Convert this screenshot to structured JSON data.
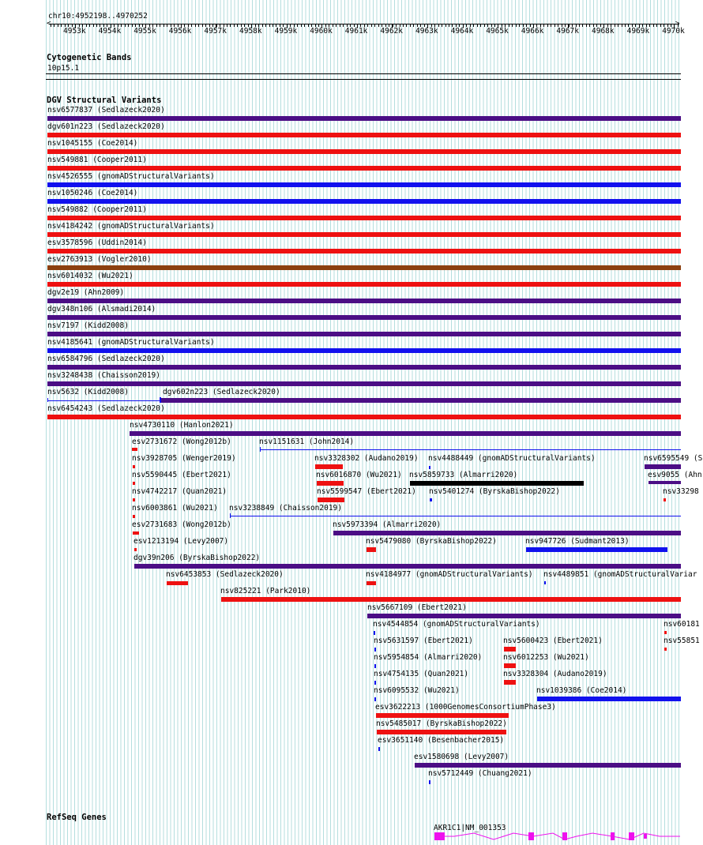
{
  "colors": {
    "red": "#ee1111",
    "blue": "#1111ee",
    "purple": "#4b0e85",
    "brown": "#8c4010",
    "black": "#000000",
    "magenta": "#ee11ee",
    "grid": "#b4dede"
  },
  "ruler": {
    "position_label": "chr10:4952198..4970252",
    "ticks": [
      "4953k",
      "4954k",
      "4955k",
      "4956k",
      "4957k",
      "4958k",
      "4959k",
      "4960k",
      "4961k",
      "4962k",
      "4963k",
      "4964k",
      "4965k",
      "4966k",
      "4967k",
      "4968k",
      "4969k",
      "4970k"
    ]
  },
  "cytoband": {
    "title": "Cytogenetic Bands",
    "band_label": "10p15.1"
  },
  "dgv": {
    "title": "DGV Structural Variants",
    "features": [
      {
        "label": "nsv6577837 (Sedlazeck2020)",
        "color": "purple"
      },
      {
        "label": "dgv601n223 (Sedlazeck2020)",
        "color": "red"
      },
      {
        "label": "nsv1045155 (Coe2014)",
        "color": "red"
      },
      {
        "label": "nsv549881 (Cooper2011)",
        "color": "red"
      },
      {
        "label": "nsv4526555 (gnomADStructuralVariants)",
        "color": "blue"
      },
      {
        "label": "nsv1050246 (Coe2014)",
        "color": "blue"
      },
      {
        "label": "nsv549882 (Cooper2011)",
        "color": "red"
      },
      {
        "label": "nsv4184242 (gnomADStructuralVariants)",
        "color": "red"
      },
      {
        "label": "esv3578596 (Uddin2014)",
        "color": "red"
      },
      {
        "label": "esv2763913 (Vogler2010)",
        "color": "brown"
      },
      {
        "label": "nsv6014032 (Wu2021)",
        "color": "red"
      },
      {
        "label": "dgv2e19 (Ahn2009)",
        "color": "purple"
      },
      {
        "label": "dgv348n106 (Alsmadi2014)",
        "color": "purple"
      },
      {
        "label": "nsv7197 (Kidd2008)",
        "color": "purple"
      },
      {
        "label": "nsv4185641 (gnomADStructuralVariants)",
        "color": "blue"
      },
      {
        "label": "nsv6584796 (Sedlazeck2020)",
        "color": "purple"
      },
      {
        "label": "nsv3248438 (Chaisson2019)",
        "color": "purple"
      },
      {
        "label": "nsv5632 (Kidd2008)",
        "color": "blue"
      },
      {
        "label": "dgv602n223 (Sedlazeck2020)",
        "color": "purple"
      },
      {
        "label": "nsv6454243 (Sedlazeck2020)",
        "color": "red"
      },
      {
        "label": "nsv4730110 (Hanlon2021)",
        "color": "purple"
      },
      {
        "label": "esv2731672 (Wong2012b)",
        "color": "red"
      },
      {
        "label": "nsv1151631 (John2014)",
        "color": "blue"
      },
      {
        "label": "nsv3928705 (Wenger2019)",
        "color": "red"
      },
      {
        "label": "nsv3328302 (Audano2019)",
        "color": "red"
      },
      {
        "label": "nsv4488449 (gnomADStructuralVariants)",
        "color": "blue"
      },
      {
        "label": "nsv6595549 (S",
        "color": "purple"
      },
      {
        "label": "nsv5590445 (Ebert2021)",
        "color": "red"
      },
      {
        "label": "nsv6016870 (Wu2021)",
        "color": "red"
      },
      {
        "label": "nsv5859733 (Almarri2020)",
        "color": "black"
      },
      {
        "label": "esv9055 (Ahn",
        "color": "purple"
      },
      {
        "label": "nsv4742217 (Quan2021)",
        "color": "red"
      },
      {
        "label": "nsv5599547 (Ebert2021)",
        "color": "red"
      },
      {
        "label": "nsv5401274 (ByrskaBishop2022)",
        "color": "blue"
      },
      {
        "label": "nsv33298",
        "color": "red"
      },
      {
        "label": "nsv6003861 (Wu2021)",
        "color": "red"
      },
      {
        "label": "nsv3238849 (Chaisson2019)",
        "color": "blue"
      },
      {
        "label": "esv2731683 (Wong2012b)",
        "color": "red"
      },
      {
        "label": "nsv5973394 (Almarri2020)",
        "color": "purple"
      },
      {
        "label": "esv1213194 (Levy2007)",
        "color": "red"
      },
      {
        "label": "nsv5479080 (ByrskaBishop2022)",
        "color": "red"
      },
      {
        "label": "nsv947726 (Sudmant2013)",
        "color": "blue"
      },
      {
        "label": "dgv39n206 (ByrskaBishop2022)",
        "color": "purple"
      },
      {
        "label": "nsv6453853 (Sedlazeck2020)",
        "color": "red"
      },
      {
        "label": "nsv4184977 (gnomADStructuralVariants)",
        "color": "red"
      },
      {
        "label": "nsv4489851 (gnomADStructuralVariar",
        "color": "blue"
      },
      {
        "label": "nsv825221 (Park2010)",
        "color": "red"
      },
      {
        "label": "nsv5667109 (Ebert2021)",
        "color": "purple"
      },
      {
        "label": "nsv4544854 (gnomADStructuralVariants)",
        "color": "blue"
      },
      {
        "label": "nsv60181",
        "color": "red"
      },
      {
        "label": "nsv5631597 (Ebert2021)",
        "color": "blue"
      },
      {
        "label": "nsv5600423 (Ebert2021)",
        "color": "red"
      },
      {
        "label": "nsv55851",
        "color": "red"
      },
      {
        "label": "nsv5954854 (Almarri2020)",
        "color": "blue"
      },
      {
        "label": "nsv6012253 (Wu2021)",
        "color": "red"
      },
      {
        "label": "nsv4754135 (Quan2021)",
        "color": "blue"
      },
      {
        "label": "nsv3328304 (Audano2019)",
        "color": "red"
      },
      {
        "label": "nsv6095532 (Wu2021)",
        "color": "blue"
      },
      {
        "label": "nsv1039386 (Coe2014)",
        "color": "blue"
      },
      {
        "label": "esv3622213 (1000GenomesConsortiumPhase3)",
        "color": "red"
      },
      {
        "label": "nsv5485017 (ByrskaBishop2022)",
        "color": "red"
      },
      {
        "label": "esv3651140 (Besenbacher2015)",
        "color": "blue"
      },
      {
        "label": "esv1580698 (Levy2007)",
        "color": "purple"
      },
      {
        "label": "nsv5712449 (Chuang2021)",
        "color": "blue"
      }
    ]
  },
  "refseq": {
    "title": "RefSeq Genes",
    "gene_label": "AKR1C1|NM_001353"
  }
}
